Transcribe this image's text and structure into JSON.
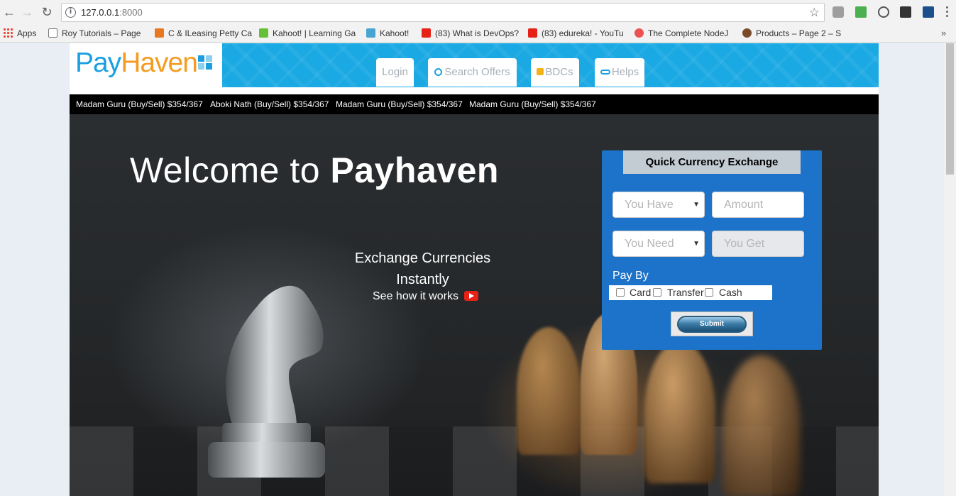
{
  "browser": {
    "url_host": "127.0.0.1",
    "url_port": ":8000",
    "bookmarks": [
      {
        "label": "Apps"
      },
      {
        "label": "Roy Tutorials – Page"
      },
      {
        "label": "C & ILeasing Petty Ca"
      },
      {
        "label": "Kahoot! | Learning Ga"
      },
      {
        "label": "Kahoot!"
      },
      {
        "label": "(83) What is DevOps?"
      },
      {
        "label": "(83) edureka! - YouTu"
      },
      {
        "label": "The Complete NodeJ"
      },
      {
        "label": "Products – Page 2 – S"
      }
    ],
    "more_bookmarks": "»"
  },
  "site": {
    "logo": {
      "part1": "Pay",
      "part2": "Haven"
    },
    "nav": [
      {
        "label": "Login",
        "icon": null
      },
      {
        "label": "Search Offers",
        "icon": "search-icon"
      },
      {
        "label": "BDCs",
        "icon": "bdc-icon"
      },
      {
        "label": "Helps",
        "icon": "help-icon"
      }
    ],
    "ticker": [
      "Madam Guru (Buy/Sell) $354/367",
      "Aboki Nath (Buy/Sell) $354/367",
      "Madam Guru (Buy/Sell) $354/367",
      "Madam Guru (Buy/Sell) $354/367"
    ],
    "hero": {
      "welcome_prefix": "Welcome to ",
      "welcome_brand": "Payhaven",
      "exchange_line1": "Exchange Currencies",
      "exchange_line2": "Instantly",
      "how_it_works": "See how it works"
    },
    "exchange_form": {
      "title": "Quick Currency Exchange",
      "you_have": "You Have",
      "amount": "Amount",
      "you_need": "You Need",
      "you_get": "You Get",
      "pay_by": "Pay By",
      "options": [
        "Card",
        "Transfer",
        "Cash"
      ],
      "submit": "Submit"
    }
  },
  "colors": {
    "brand_blue": "#1aa9e3",
    "logo_orange": "#f39c21",
    "card_blue": "#1c73c9"
  }
}
